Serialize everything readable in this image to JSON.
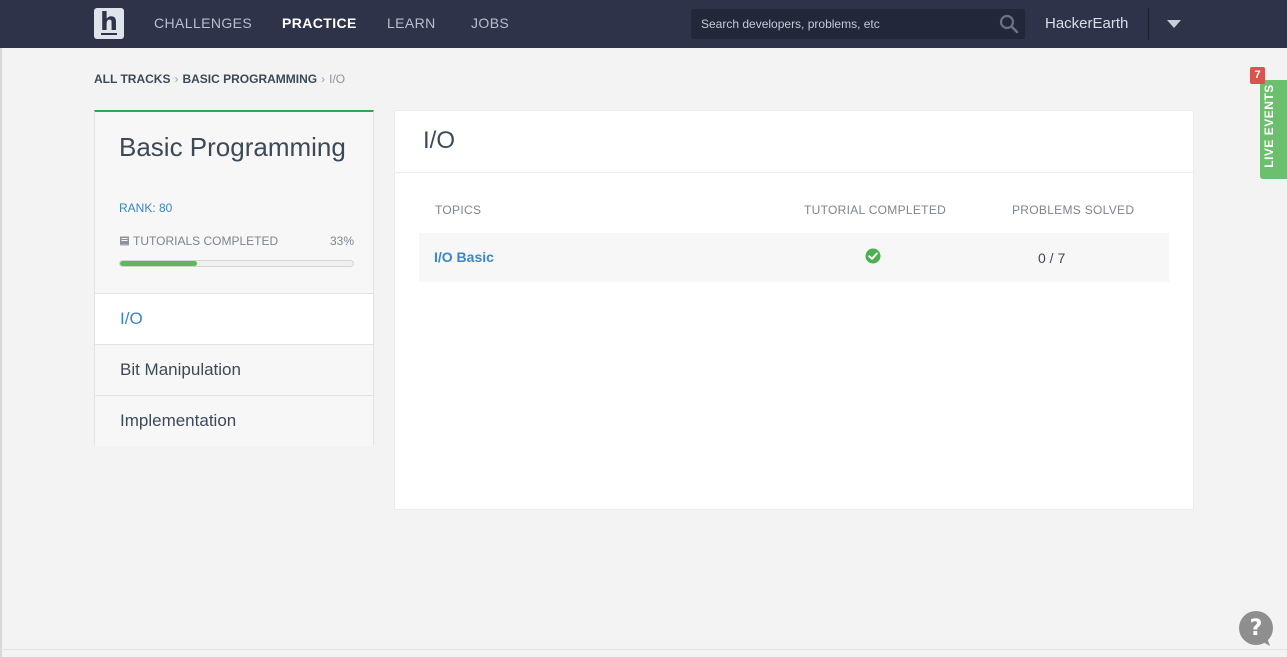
{
  "nav": {
    "logo_letter": "h",
    "links": [
      "CHALLENGES",
      "PRACTICE",
      "LEARN",
      "JOBS"
    ],
    "active_link": "PRACTICE",
    "search_placeholder": "Search developers, problems, etc",
    "user_name": "HackerEarth"
  },
  "breadcrumb": {
    "items": [
      "ALL TRACKS",
      "BASIC PROGRAMMING"
    ],
    "current": "I/O",
    "separator": "›"
  },
  "track": {
    "title": "Basic Programming",
    "rank": "RANK: 80",
    "tutorials_label": "TUTORIALS COMPLETED",
    "tutorials_percent_text": "33%",
    "tutorials_progress": 0.33,
    "subtopics": [
      "I/O",
      "Bit Manipulation",
      "Implementation"
    ],
    "active_subtopic": "I/O"
  },
  "panel": {
    "title": "I/O",
    "headers": {
      "topics": "TOPICS",
      "tutorial_completed": "TUTORIAL COMPLETED",
      "problems_solved": "PROBLEMS SOLVED"
    },
    "rows": [
      {
        "topic": "I/O Basic",
        "tutorial_completed": true,
        "problems_solved": "0 / 7"
      }
    ]
  },
  "live_events": {
    "label": "LIVE EVENTS",
    "badge_count": "7"
  },
  "colors": {
    "nav_bg": "#2f3349",
    "accent_green": "#2fa84f",
    "link_blue": "#3a86c8",
    "badge_red": "#d9534f"
  }
}
